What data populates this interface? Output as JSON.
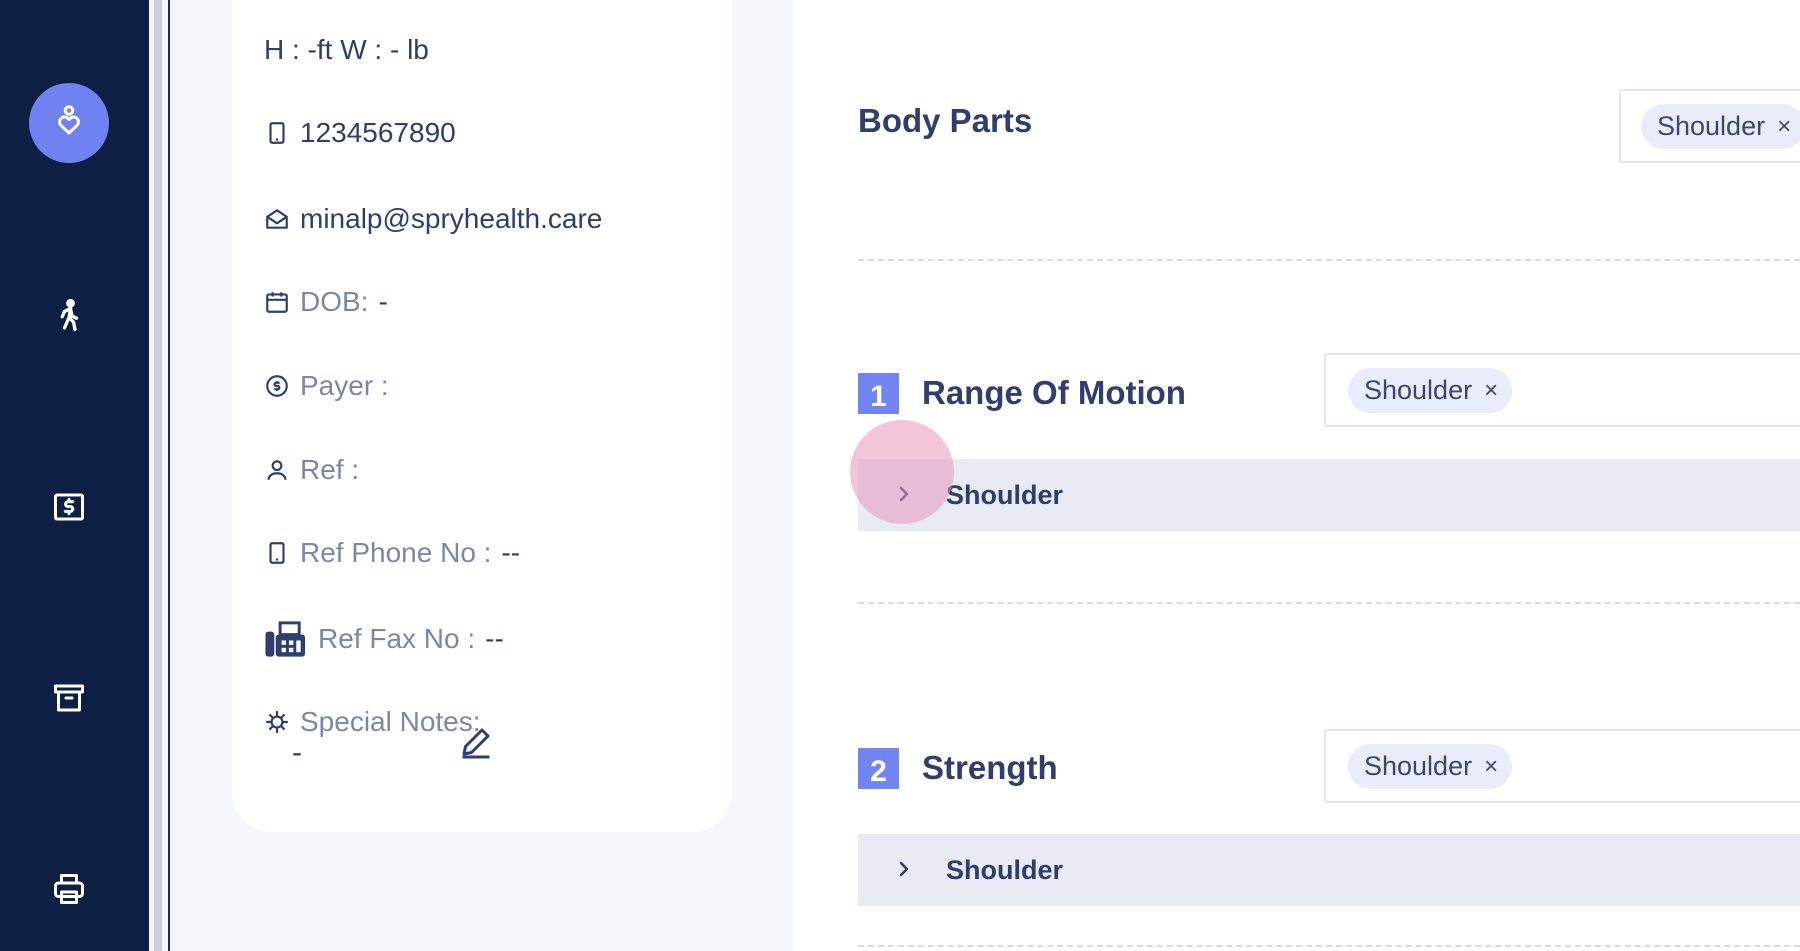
{
  "sidebar": {
    "items": [
      {
        "icon": "heart-person-icon",
        "active": true
      },
      {
        "icon": "walking-person-icon",
        "active": false
      },
      {
        "icon": "dollar-document-icon",
        "active": false
      },
      {
        "icon": "archive-box-icon",
        "active": false
      },
      {
        "icon": "printer-icon",
        "active": false
      }
    ]
  },
  "patient": {
    "height_weight": "H : -ft W : - lb",
    "phone": "1234567890",
    "email": "minalp@spryhealth.care",
    "dob_label": "DOB:",
    "dob_value": "-",
    "payer_label": "Payer :",
    "ref_label": "Ref :",
    "ref_phone_label": "Ref Phone No :",
    "ref_phone_value": "--",
    "ref_fax_label": "Ref Fax No :",
    "ref_fax_value": "--",
    "special_notes_label": "Special Notes:",
    "special_notes_value": "-"
  },
  "main": {
    "body_parts": {
      "title": "Body Parts",
      "chip": "Shoulder",
      "chip_remove": "×"
    },
    "sections": [
      {
        "number": "1",
        "title": "Range Of Motion",
        "chip": "Shoulder",
        "chip_remove": "×",
        "accordion_label": "Shoulder"
      },
      {
        "number": "2",
        "title": "Strength",
        "chip": "Shoulder",
        "chip_remove": "×",
        "accordion_label": "Shoulder"
      }
    ]
  },
  "colors": {
    "sidebar_bg": "#0e1f44",
    "accent": "#7384f3",
    "text_primary": "#2f3d70",
    "text_muted": "#7b86ad",
    "chip_bg": "#e9ecfb",
    "accordion_bg": "#e8ebf3"
  }
}
